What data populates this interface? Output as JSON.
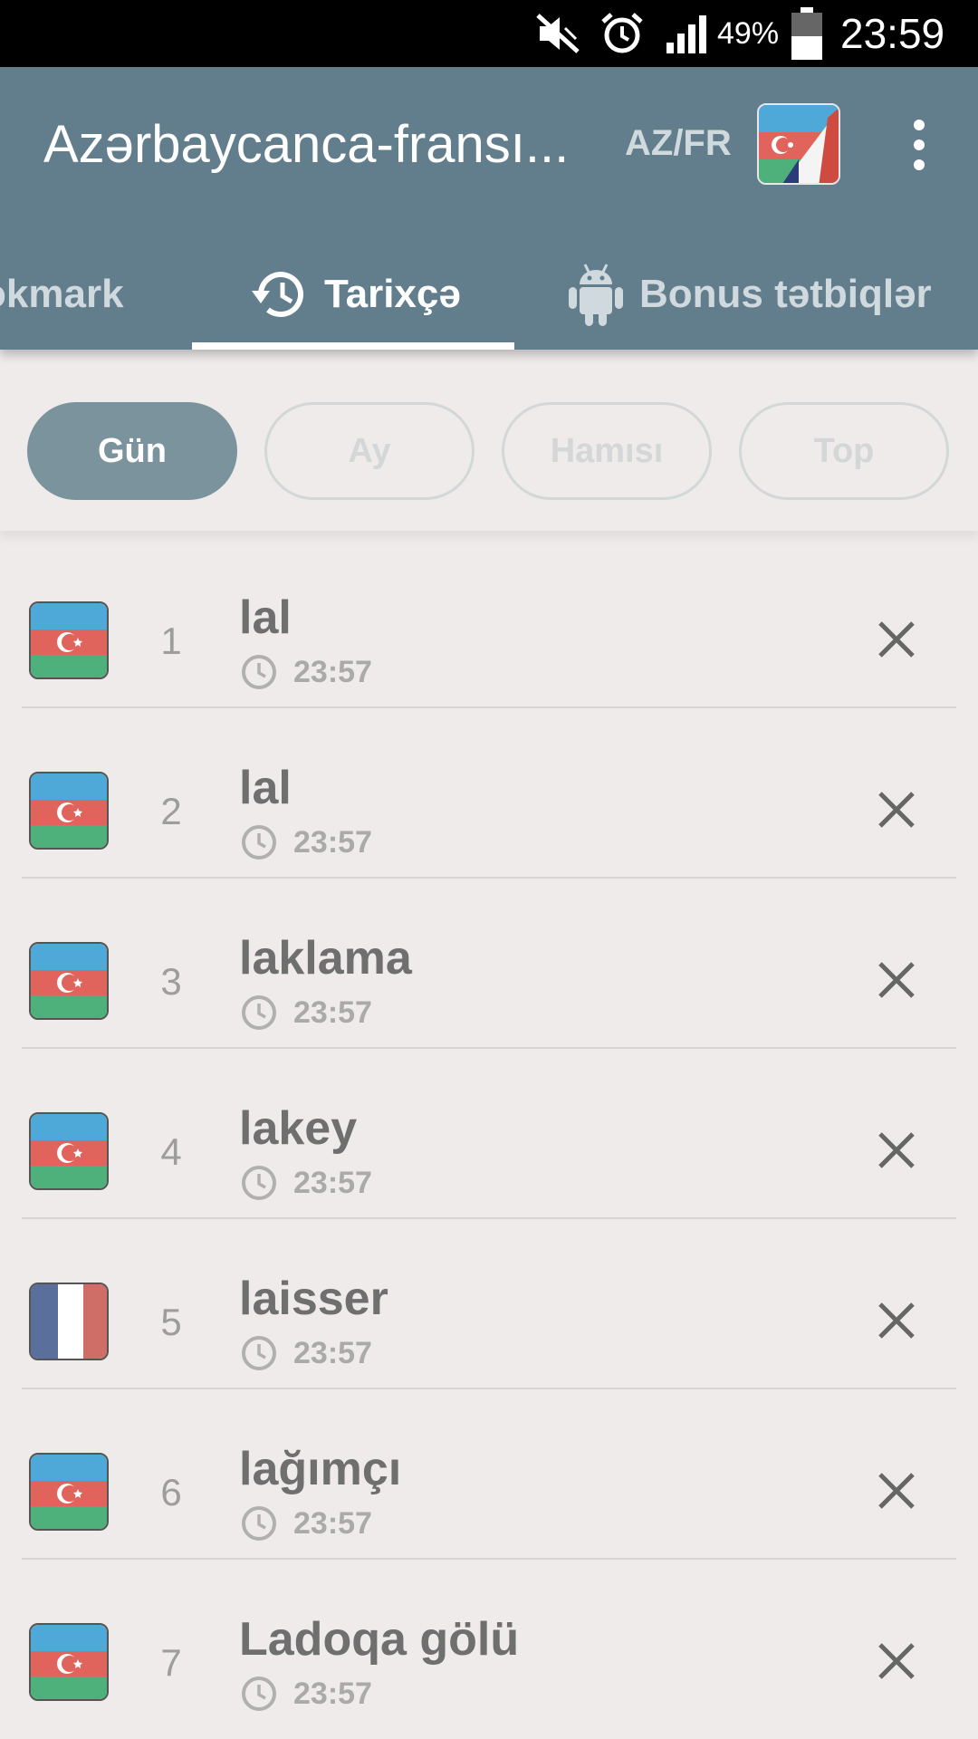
{
  "status_bar": {
    "battery_percent": "49%",
    "time": "23:59",
    "icons": [
      "mute-icon",
      "alarm-icon",
      "signal-icon",
      "battery-icon"
    ]
  },
  "app_bar": {
    "title": "Azərbaycanca-fransı...",
    "language_pair": "AZ/FR",
    "flag_icon": "az-fr-flag-icon",
    "menu_icon": "more-vert-icon"
  },
  "tabs": [
    {
      "label": "okmark",
      "icon": "bookmark-icon",
      "active": false
    },
    {
      "label": "Tarixçə",
      "icon": "history-icon",
      "active": true
    },
    {
      "label": "Bonus tətbiqlər",
      "icon": "android-icon",
      "active": false
    }
  ],
  "filters": [
    {
      "label": "Gün",
      "active": true
    },
    {
      "label": "Ay",
      "active": false
    },
    {
      "label": "Hamısı",
      "active": false
    },
    {
      "label": "Top",
      "active": false
    }
  ],
  "history": [
    {
      "index": "1",
      "word": "lal",
      "time": "23:57",
      "lang": "az"
    },
    {
      "index": "2",
      "word": "lal",
      "time": "23:57",
      "lang": "az"
    },
    {
      "index": "3",
      "word": "laklama",
      "time": "23:57",
      "lang": "az"
    },
    {
      "index": "4",
      "word": "lakey",
      "time": "23:57",
      "lang": "az"
    },
    {
      "index": "5",
      "word": "laisser",
      "time": "23:57",
      "lang": "fr"
    },
    {
      "index": "6",
      "word": "lağımçı",
      "time": "23:57",
      "lang": "az"
    },
    {
      "index": "7",
      "word": "Ladoqa gölü",
      "time": "23:57",
      "lang": "az"
    }
  ],
  "colors": {
    "app_bar": "#627e8c",
    "active_chip": "#7a939d",
    "background": "#efebeb",
    "az_blue": "#4fa9d8",
    "az_red": "#e0635c",
    "az_green": "#4eb07a",
    "fr_blue": "#5a6f9b",
    "fr_red": "#cf6e66"
  }
}
